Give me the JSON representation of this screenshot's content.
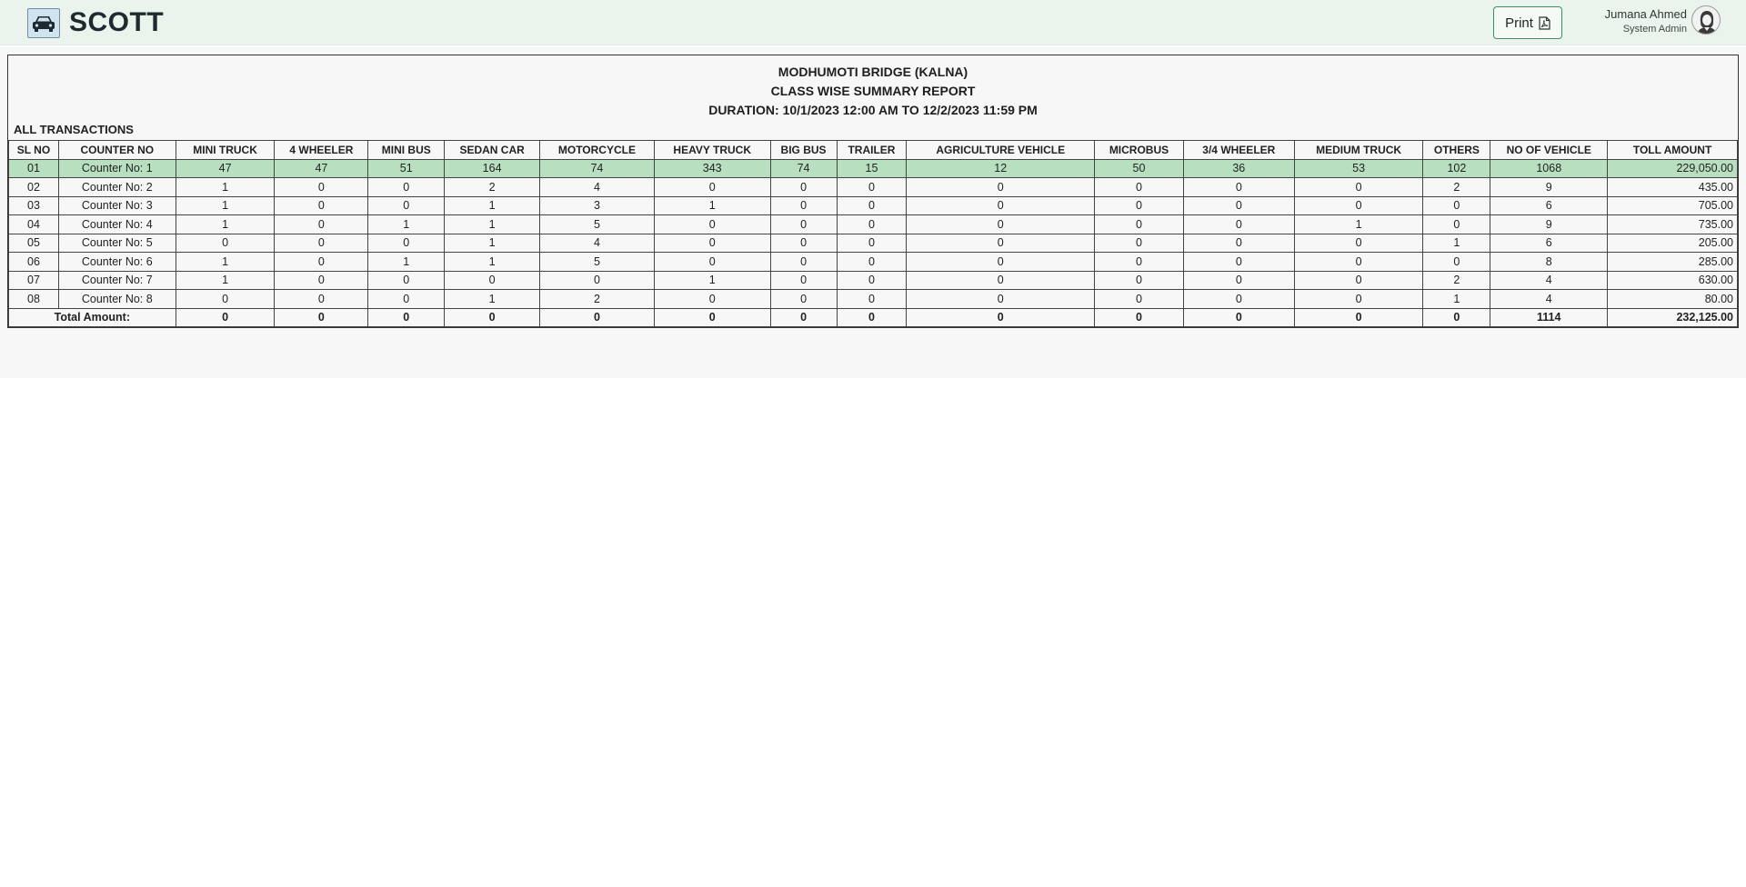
{
  "header": {
    "brand": "SCOTT",
    "print_label": "Print",
    "user_name": "Jumana Ahmed",
    "user_role": "System Admin"
  },
  "report": {
    "title": "MODHUMOTI BRIDGE (KALNA)",
    "subtitle": "CLASS WISE SUMMARY REPORT",
    "duration": "DURATION: 10/1/2023 12:00 AM TO 12/2/2023 11:59 PM",
    "section": "ALL TRANSACTIONS",
    "columns": [
      "SL NO",
      "COUNTER NO",
      "MINI TRUCK",
      "4 WHEELER",
      "MINI BUS",
      "SEDAN CAR",
      "MOTORCYCLE",
      "HEAVY TRUCK",
      "BIG BUS",
      "TRAILER",
      "AGRICULTURE VEHICLE",
      "MICROBUS",
      "3/4 WHEELER",
      "MEDIUM TRUCK",
      "OTHERS",
      "NO OF VEHICLE",
      "TOLL AMOUNT"
    ],
    "rows": [
      [
        "01",
        "Counter No: 1",
        "47",
        "47",
        "51",
        "164",
        "74",
        "343",
        "74",
        "15",
        "12",
        "50",
        "36",
        "53",
        "102",
        "1068",
        "229,050.00"
      ],
      [
        "02",
        "Counter No: 2",
        "1",
        "0",
        "0",
        "2",
        "4",
        "0",
        "0",
        "0",
        "0",
        "0",
        "0",
        "0",
        "2",
        "9",
        "435.00"
      ],
      [
        "03",
        "Counter No: 3",
        "1",
        "0",
        "0",
        "1",
        "3",
        "1",
        "0",
        "0",
        "0",
        "0",
        "0",
        "0",
        "0",
        "6",
        "705.00"
      ],
      [
        "04",
        "Counter No: 4",
        "1",
        "0",
        "1",
        "1",
        "5",
        "0",
        "0",
        "0",
        "0",
        "0",
        "0",
        "1",
        "0",
        "9",
        "735.00"
      ],
      [
        "05",
        "Counter No: 5",
        "0",
        "0",
        "0",
        "1",
        "4",
        "0",
        "0",
        "0",
        "0",
        "0",
        "0",
        "0",
        "1",
        "6",
        "205.00"
      ],
      [
        "06",
        "Counter No: 6",
        "1",
        "0",
        "1",
        "1",
        "5",
        "0",
        "0",
        "0",
        "0",
        "0",
        "0",
        "0",
        "0",
        "8",
        "285.00"
      ],
      [
        "07",
        "Counter No: 7",
        "1",
        "0",
        "0",
        "0",
        "0",
        "1",
        "0",
        "0",
        "0",
        "0",
        "0",
        "0",
        "2",
        "4",
        "630.00"
      ],
      [
        "08",
        "Counter No: 8",
        "0",
        "0",
        "0",
        "1",
        "2",
        "0",
        "0",
        "0",
        "0",
        "0",
        "0",
        "0",
        "1",
        "4",
        "80.00"
      ]
    ],
    "total_label": "Total Amount:",
    "totals": [
      "0",
      "0",
      "0",
      "0",
      "0",
      "0",
      "0",
      "0",
      "0",
      "0",
      "0",
      "0",
      "0",
      "1114",
      "232,125.00"
    ]
  }
}
